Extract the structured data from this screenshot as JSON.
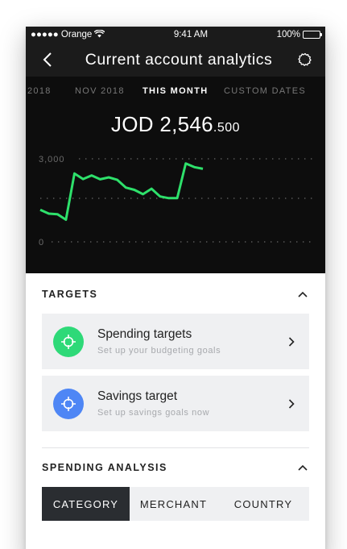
{
  "status_bar": {
    "carrier": "●●●●● Orange",
    "time": "9:41 AM",
    "battery": "100%"
  },
  "nav": {
    "title": "Current account analytics"
  },
  "periods": [
    {
      "label": "2018",
      "active": false
    },
    {
      "label": "NOV 2018",
      "active": false
    },
    {
      "label": "THIS MONTH",
      "active": true
    },
    {
      "label": "CUSTOM DATES",
      "active": false
    }
  ],
  "balance": {
    "currency_whole": "JOD 2,546",
    "decimal": ".500"
  },
  "chart_data": {
    "type": "line",
    "y_tick_labels": [
      "3,000",
      "0"
    ],
    "ylim": [
      0,
      3000
    ],
    "grid": true,
    "line_color": "#2ee06b",
    "x": [
      1,
      2,
      3,
      4,
      5,
      6,
      7,
      8,
      9,
      10,
      11,
      12,
      13,
      14,
      15,
      16,
      17,
      18,
      19,
      20
    ],
    "values": [
      1160,
      1020,
      1000,
      800,
      2470,
      2270,
      2400,
      2260,
      2330,
      2240,
      1960,
      1880,
      1720,
      1920,
      1640,
      1580,
      1580,
      2830,
      2700,
      2640
    ]
  },
  "targets": {
    "heading": "TARGETS",
    "items": [
      {
        "title": "Spending targets",
        "subtitle": "Set up your budgeting goals",
        "icon": "crosshair-icon",
        "color": "#2ed978"
      },
      {
        "title": "Savings target",
        "subtitle": "Set up savings goals now",
        "icon": "crosshair-icon",
        "color": "#4e86f5"
      }
    ]
  },
  "spending": {
    "heading": "SPENDING ANALYSIS",
    "tabs": [
      {
        "label": "CATEGORY",
        "active": true
      },
      {
        "label": "MERCHANT",
        "active": false
      },
      {
        "label": "COUNTRY",
        "active": false
      }
    ]
  }
}
